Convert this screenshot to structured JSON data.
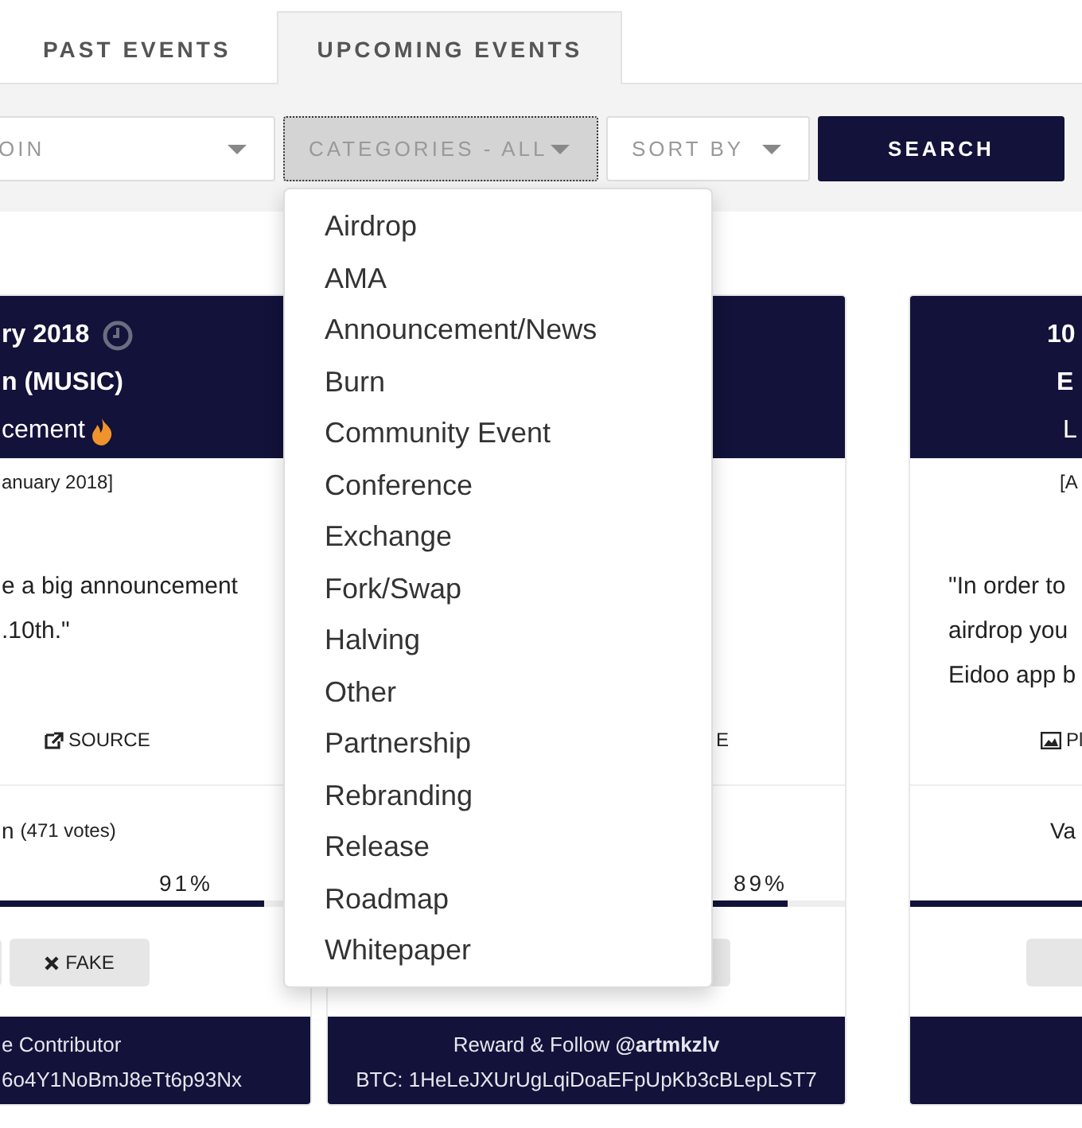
{
  "tabs": [
    {
      "label": "PAST EVENTS",
      "selected": false
    },
    {
      "label": "UPCOMING EVENTS",
      "selected": true
    }
  ],
  "filters": [
    {
      "kind": "select",
      "label": "OIN",
      "expanded": false
    },
    {
      "kind": "select",
      "label": "CATEGORIES - ALL",
      "expanded": true
    },
    {
      "kind": "select",
      "label": "SORT BY",
      "expanded": false
    },
    {
      "kind": "button",
      "label": "SEARCH"
    }
  ],
  "category_options": [
    "Airdrop",
    "AMA",
    "Announcement/News",
    "Burn",
    "Community Event",
    "Conference",
    "Exchange",
    "Fork/Swap",
    "Halving",
    "Other",
    "Partnership",
    "Rebranding",
    "Release",
    "Roadmap",
    "Whitepaper"
  ],
  "cards": [
    {
      "title": "ry 2018",
      "coin": "n (MUSIC)",
      "type": "cement",
      "added": "anuary 2018]",
      "description": [
        "e a big announcement",
        ".10th.\""
      ],
      "source": "SOURCE",
      "votes": "n",
      "vote_count": "(471 votes)",
      "percent": "91%",
      "level": 0.91,
      "fake_label": "FAKE",
      "footer": [
        "e Contributor",
        "6o4Y1NoBmJ8eTt6p93Nx"
      ]
    },
    {
      "source": "E",
      "percent": "89%",
      "level": 0.89,
      "footer": [
        "Reward & Follow **@artmkzlv**",
        "BTC: 1HeLeJXUrUgLqiDoaEFpUpKb3cBLepLST7"
      ]
    },
    {
      "title": "10",
      "coin": "E",
      "type": "L",
      "added": "[A",
      "description": [
        "\"In order to",
        "airdrop you",
        "Eidoo app b"
      ],
      "source": "Pl",
      "votes": "Va",
      "level": 1
    }
  ]
}
